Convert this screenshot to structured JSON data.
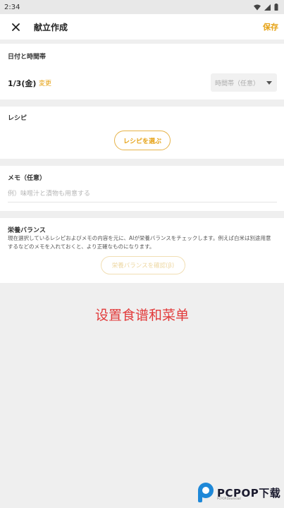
{
  "status_bar": {
    "time": "2:34"
  },
  "app_bar": {
    "title": "献立作成",
    "save_label": "保存"
  },
  "date_section": {
    "label": "日付と時間帯",
    "date_value": "1/3(金)",
    "change_label": "変更",
    "time_slot_placeholder": "時間帯（任意）"
  },
  "recipe_section": {
    "label": "レシピ",
    "button_label": "レシピを選ぶ"
  },
  "memo_section": {
    "label": "メモ（任意）",
    "placeholder": "例）味噌汁と漬物も用意する",
    "value": ""
  },
  "nutrition_section": {
    "label": "栄養バランス",
    "description": "現在選択しているレシピおよびメモの内容を元に、AIが栄養バランスをチェックします。例えば白米は別途用意するなどのメモを入れておくと、より正確なものになります。",
    "button_label": "栄養バランスを確認(β)"
  },
  "caption": "设置食谱和菜单",
  "watermark": {
    "text": "PCPOP下载",
    "sub": "PCPOP.Download"
  },
  "colors": {
    "accent": "#e6a317",
    "caption": "#e23b3b",
    "background": "#efefef"
  }
}
